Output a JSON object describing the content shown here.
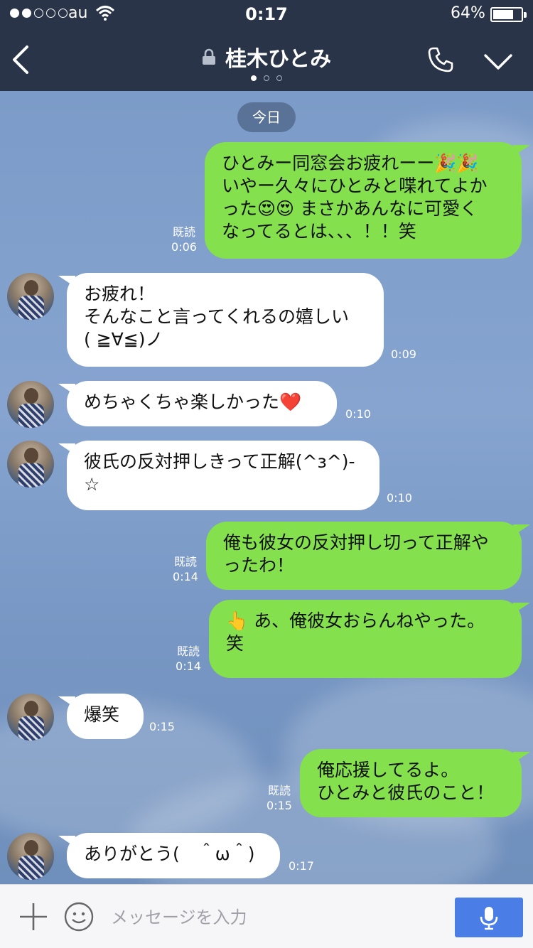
{
  "status_bar": {
    "carrier": "au",
    "time": "0:17",
    "battery": "64%",
    "signal_bars": 2,
    "signal_total": 5
  },
  "header": {
    "title": "桂木ひとみ",
    "pages": 3,
    "active_page": 0
  },
  "date_pill": "今日",
  "messages": [
    {
      "side": "mine",
      "lines": [
        "ひとみー同窓会お疲れーー🎉🎉",
        "いやー久々にひとみと喋れてよか",
        "った😍😍 まさかあんなに可愛く",
        "なってるとは、、、！！笑"
      ],
      "read": "既読",
      "time": "0:06"
    },
    {
      "side": "theirs",
      "lines": [
        "お疲れ！",
        "そんなこと言ってくれるの嬉しい",
        "( ≧∀≦)ノ"
      ],
      "time": "0:09"
    },
    {
      "side": "theirs",
      "lines": [
        "めちゃくちゃ楽しかった❤️"
      ],
      "time": "0:10"
    },
    {
      "side": "theirs",
      "lines": [
        "彼氏の反対押しきって正解(^з^)-",
        "☆"
      ],
      "time": "0:10"
    },
    {
      "side": "mine",
      "lines": [
        "俺も彼女の反対押し切って正解や",
        "ったわ！"
      ],
      "read": "既読",
      "time": "0:14"
    },
    {
      "side": "mine",
      "lines": [
        "👆 あ、俺彼女おらんねやった。",
        "笑"
      ],
      "read": "既読",
      "time": "0:14"
    },
    {
      "side": "theirs",
      "lines": [
        "爆笑"
      ],
      "time": "0:15"
    },
    {
      "side": "mine",
      "lines": [
        "俺応援してるよ。",
        "ひとみと彼氏のこと！"
      ],
      "read": "既読",
      "time": "0:15"
    },
    {
      "side": "theirs",
      "lines": [
        "ありがとう(　＾ω＾)"
      ],
      "time": "0:17"
    }
  ],
  "input": {
    "placeholder": "メッセージを入力"
  },
  "colors": {
    "header": "#2a3448",
    "mine_bubble": "#84e04c",
    "theirs_bubble": "#ffffff",
    "send_button": "#4a7ee6"
  }
}
